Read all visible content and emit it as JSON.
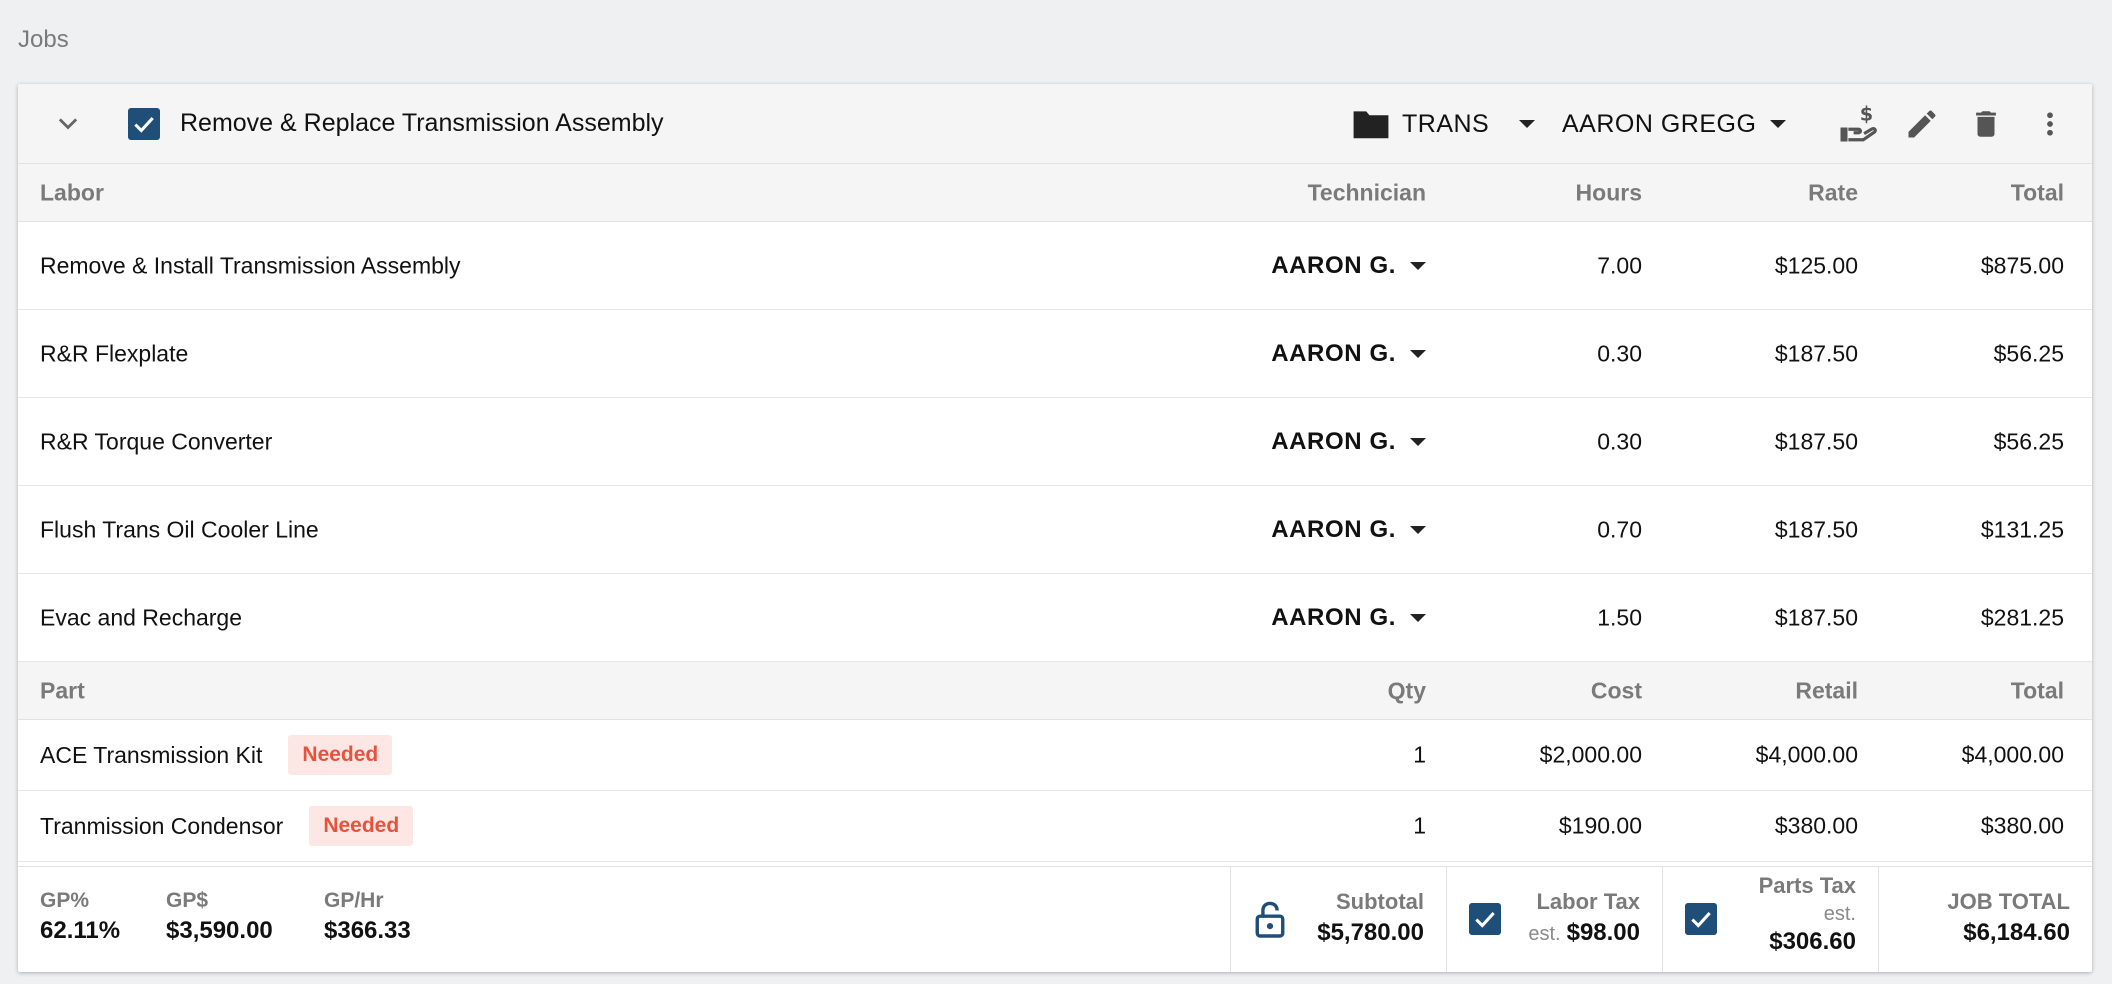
{
  "page": {
    "title": "Jobs"
  },
  "job": {
    "title": "Remove & Replace Transmission Assembly",
    "category": "TRANS",
    "technician": "AARON GREGG"
  },
  "labor": {
    "headers": {
      "name": "Labor",
      "tech": "Technician",
      "hours": "Hours",
      "rate": "Rate",
      "total": "Total"
    },
    "rows": [
      {
        "name": "Remove & Install Transmission Assembly",
        "tech": "AARON G.",
        "hours": "7.00",
        "rate": "$125.00",
        "total": "$875.00"
      },
      {
        "name": "R&R Flexplate",
        "tech": "AARON G.",
        "hours": "0.30",
        "rate": "$187.50",
        "total": "$56.25"
      },
      {
        "name": "R&R Torque Converter",
        "tech": "AARON G.",
        "hours": "0.30",
        "rate": "$187.50",
        "total": "$56.25"
      },
      {
        "name": "Flush Trans Oil Cooler Line",
        "tech": "AARON G.",
        "hours": "0.70",
        "rate": "$187.50",
        "total": "$131.25"
      },
      {
        "name": "Evac and Recharge",
        "tech": "AARON G.",
        "hours": "1.50",
        "rate": "$187.50",
        "total": "$281.25"
      }
    ]
  },
  "parts": {
    "headers": {
      "name": "Part",
      "qty": "Qty",
      "cost": "Cost",
      "retail": "Retail",
      "total": "Total"
    },
    "rows": [
      {
        "name": "ACE Transmission Kit",
        "status": "Needed",
        "qty": "1",
        "cost": "$2,000.00",
        "retail": "$4,000.00",
        "total": "$4,000.00"
      },
      {
        "name": "Tranmission Condensor",
        "status": "Needed",
        "qty": "1",
        "cost": "$190.00",
        "retail": "$380.00",
        "total": "$380.00"
      }
    ]
  },
  "footer": {
    "gp_pct_label": "GP%",
    "gp_pct": "62.11%",
    "gp_dollar_label": "GP$",
    "gp_dollar": "$3,590.00",
    "gp_hr_label": "GP/Hr",
    "gp_hr": "$366.33",
    "subtotal_label": "Subtotal",
    "subtotal": "$5,780.00",
    "labor_tax_label": "Labor Tax",
    "labor_tax_est": "est.",
    "labor_tax": "$98.00",
    "parts_tax_label": "Parts Tax",
    "parts_tax_est": "est.",
    "parts_tax": "$306.60",
    "job_total_label": "JOB TOTAL",
    "job_total": "$6,184.60"
  },
  "colors": {
    "accent": "#1f4e79",
    "badge_bg": "#fde7e4",
    "badge_text": "#e5533d"
  }
}
